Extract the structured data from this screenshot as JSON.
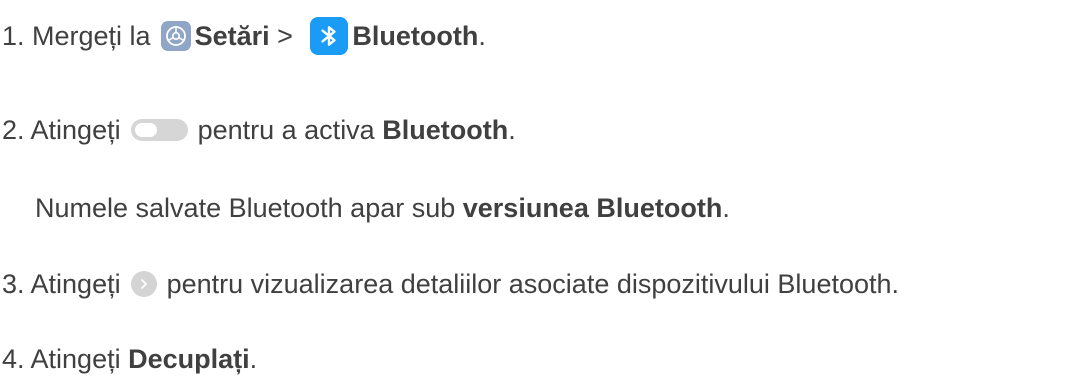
{
  "steps": {
    "s1": {
      "prefix": "1. Mergeți la",
      "settings_label": "Setări",
      "separator": " > ",
      "bluetooth_label": "Bluetooth",
      "suffix": "."
    },
    "s2": {
      "prefix": "2. Atingeți",
      "middle": "pentru a activa ",
      "bold": "Bluetooth",
      "suffix": "."
    },
    "note": {
      "prefix": "Numele salvate Bluetooth apar sub ",
      "bold": "versiunea Bluetooth",
      "suffix": "."
    },
    "s3": {
      "prefix": "3. Atingeți",
      "suffix": "pentru vizualizarea detaliilor asociate dispozitivului Bluetooth."
    },
    "s4": {
      "prefix": "4. Atingeți ",
      "bold": "Decuplați",
      "suffix": "."
    }
  },
  "icons": {
    "settings": "gear-icon",
    "bluetooth": "bluetooth-icon",
    "toggle": "toggle-switch-off",
    "details": "chevron-right-icon"
  },
  "colors": {
    "text": "#404040",
    "settings_bg": "#8fa6c9",
    "bluetooth_bg": "#1a9bf5",
    "toggle_bg": "#d6d6d6",
    "arrow_bg": "#d4d4d4"
  }
}
